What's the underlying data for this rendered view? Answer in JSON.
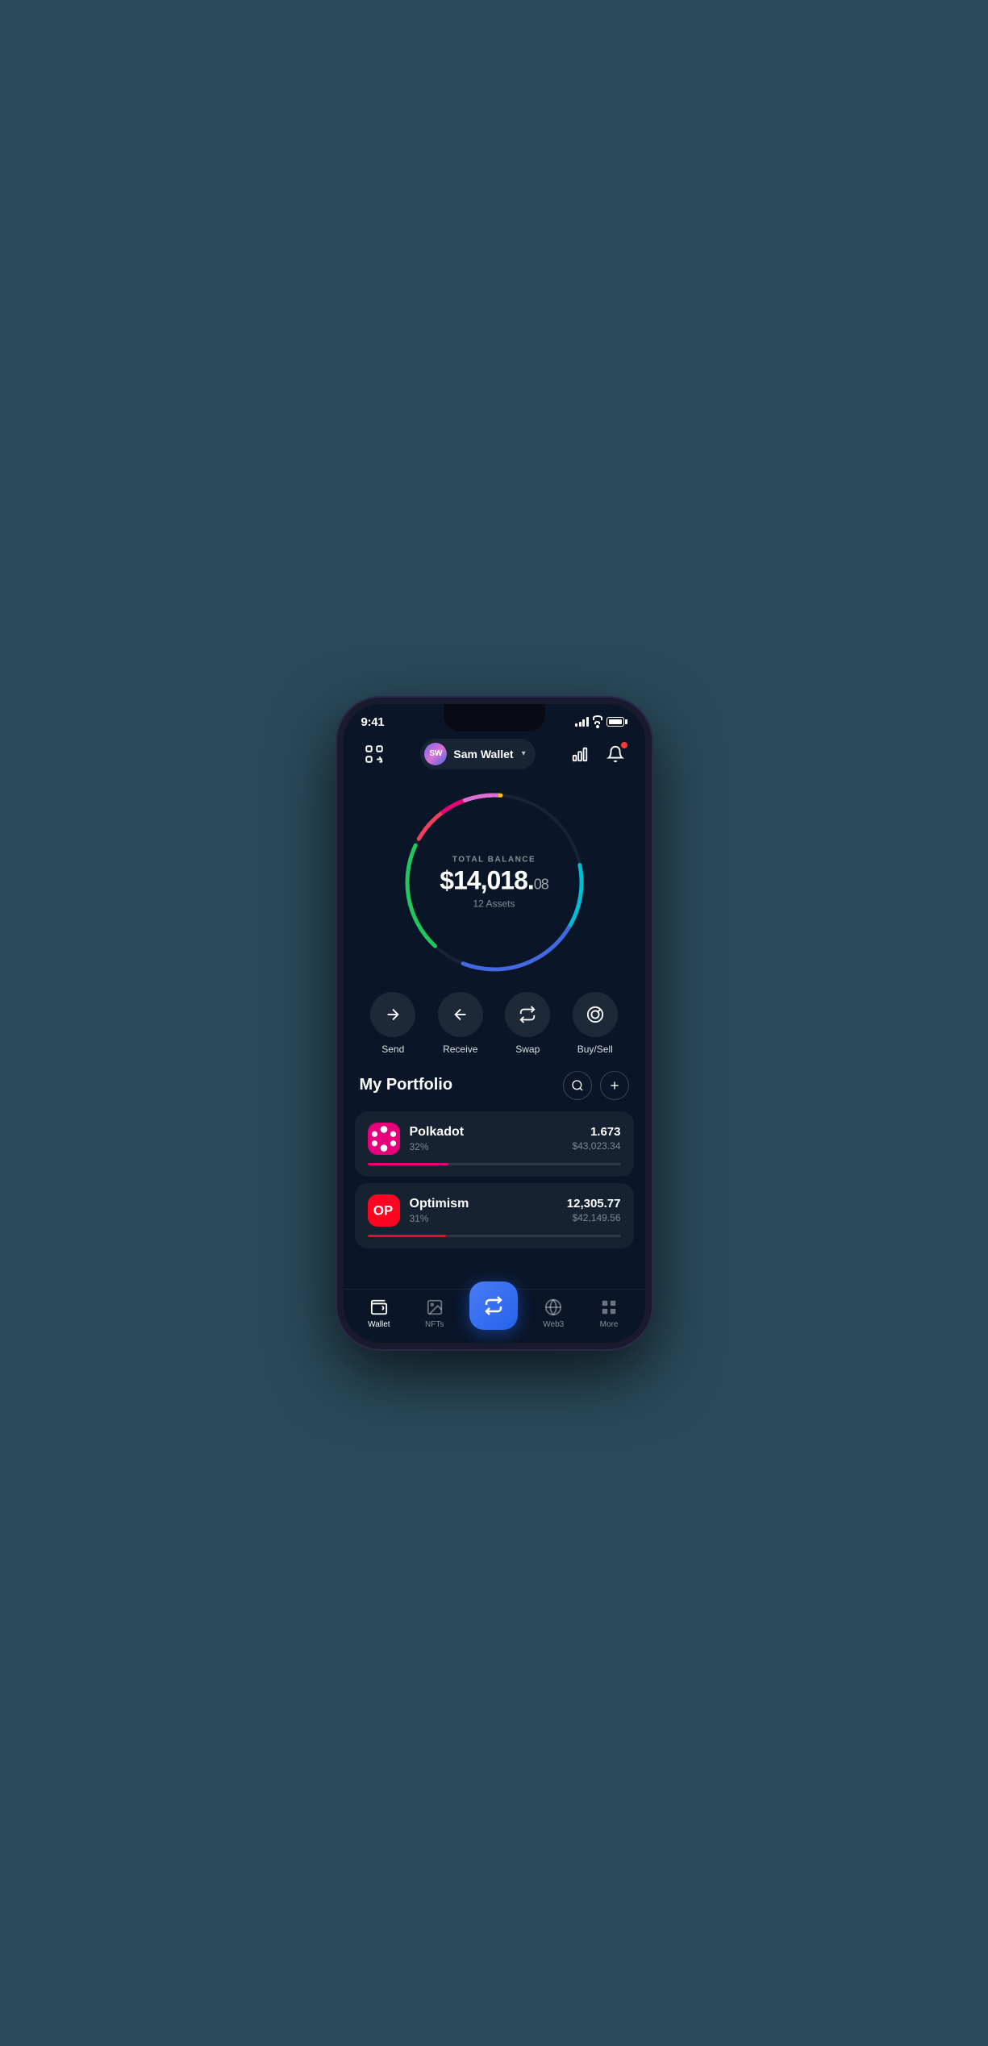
{
  "status_bar": {
    "time": "9:41"
  },
  "header": {
    "user_name": "Sam Wallet",
    "avatar_initials": "SW",
    "scan_label": "scan",
    "chart_label": "chart",
    "bell_label": "notifications"
  },
  "balance": {
    "label": "TOTAL BALANCE",
    "main": "$14,018.",
    "cents": "08",
    "assets": "12 Assets"
  },
  "actions": [
    {
      "id": "send",
      "label": "Send"
    },
    {
      "id": "receive",
      "label": "Receive"
    },
    {
      "id": "swap",
      "label": "Swap"
    },
    {
      "id": "buysell",
      "label": "Buy/Sell"
    }
  ],
  "portfolio": {
    "title": "My Portfolio",
    "search_label": "search",
    "add_label": "add"
  },
  "assets": [
    {
      "id": "polkadot",
      "name": "Polkadot",
      "pct": "32%",
      "amount": "1.673",
      "usd": "$43,023.34",
      "progress": 32,
      "color": "polkadot"
    },
    {
      "id": "optimism",
      "name": "Optimism",
      "pct": "31%",
      "amount": "12,305.77",
      "usd": "$42,149.56",
      "progress": 31,
      "color": "optimism"
    }
  ],
  "tabs": [
    {
      "id": "wallet",
      "label": "Wallet",
      "active": true
    },
    {
      "id": "nfts",
      "label": "NFTs",
      "active": false
    },
    {
      "id": "center",
      "label": "",
      "active": false
    },
    {
      "id": "web3",
      "label": "Web3",
      "active": false
    },
    {
      "id": "more",
      "label": "More",
      "active": false
    }
  ],
  "colors": {
    "background": "#0a1628",
    "card": "rgba(255,255,255,0.05)",
    "accent_blue": "#2563eb",
    "polkadot_pink": "#e6007a",
    "optimism_red": "#ff0420"
  },
  "chart_segments": [
    {
      "color": "#e6007a",
      "start": 0,
      "length": 0.08
    },
    {
      "color": "#f5c518",
      "start": 0.09,
      "length": 0.04
    },
    {
      "color": "#da70d6",
      "start": 0.14,
      "length": 0.06
    },
    {
      "color": "#00bcd4",
      "start": 0.22,
      "length": 0.12
    },
    {
      "color": "#3b82f6",
      "start": 0.36,
      "length": 0.22
    },
    {
      "color": "#22c55e",
      "start": 0.62,
      "length": 0.2
    },
    {
      "color": "#f43f5e",
      "start": 0.86,
      "length": 0.08
    }
  ]
}
